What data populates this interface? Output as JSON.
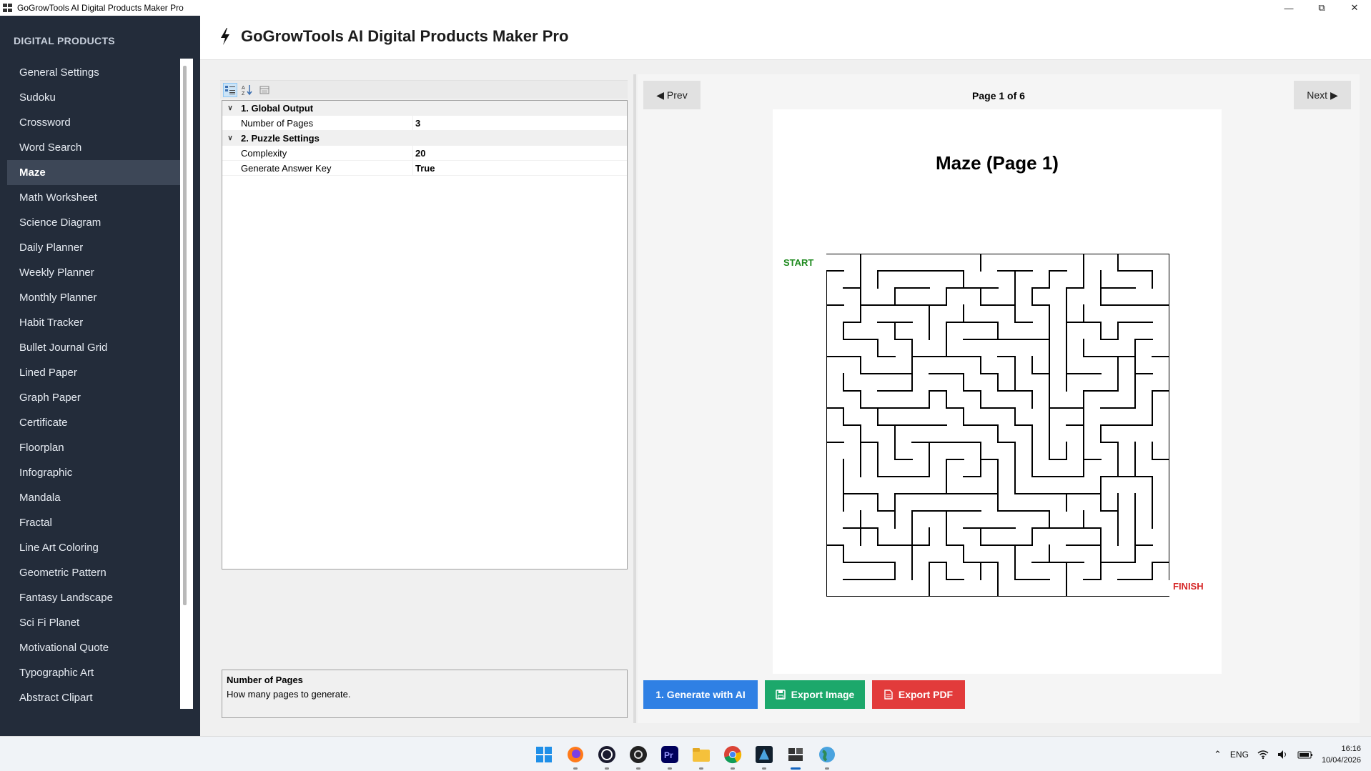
{
  "window": {
    "title": "GoGrowTools AI Digital Products Maker Pro",
    "controls": [
      "minimize",
      "restore",
      "close"
    ]
  },
  "sidebar": {
    "heading": "DIGITAL PRODUCTS",
    "items": [
      {
        "label": "General Settings"
      },
      {
        "label": "Sudoku"
      },
      {
        "label": "Crossword"
      },
      {
        "label": "Word Search"
      },
      {
        "label": "Maze",
        "active": true
      },
      {
        "label": "Math Worksheet"
      },
      {
        "label": "Science Diagram"
      },
      {
        "label": "Daily Planner"
      },
      {
        "label": "Weekly Planner"
      },
      {
        "label": "Monthly Planner"
      },
      {
        "label": "Habit Tracker"
      },
      {
        "label": "Bullet Journal Grid"
      },
      {
        "label": "Lined Paper"
      },
      {
        "label": "Graph Paper"
      },
      {
        "label": "Certificate"
      },
      {
        "label": "Floorplan"
      },
      {
        "label": "Infographic"
      },
      {
        "label": "Mandala"
      },
      {
        "label": "Fractal"
      },
      {
        "label": "Line Art Coloring"
      },
      {
        "label": "Geometric Pattern"
      },
      {
        "label": "Fantasy Landscape"
      },
      {
        "label": "Sci Fi Planet"
      },
      {
        "label": "Motivational Quote"
      },
      {
        "label": "Typographic Art"
      },
      {
        "label": "Abstract Clipart"
      }
    ]
  },
  "header": {
    "title": "GoGrowTools AI Digital Products Maker Pro",
    "icon": "lightning-bolt-icon"
  },
  "property_grid": {
    "categories": [
      {
        "name": "1. Global Output",
        "properties": [
          {
            "name": "Number of Pages",
            "value": "3"
          }
        ]
      },
      {
        "name": "2. Puzzle Settings",
        "properties": [
          {
            "name": "Complexity",
            "value": "20"
          },
          {
            "name": "Generate Answer Key",
            "value": "True"
          }
        ]
      }
    ],
    "description": {
      "title": "Number of Pages",
      "text": "How many pages to generate."
    }
  },
  "preview": {
    "prev_label": "◀ Prev",
    "next_label": "Next ▶",
    "page_label": "Page 1 of 6",
    "page_title": "Maze  (Page 1)",
    "start_label": "START",
    "finish_label": "FINISH",
    "start_color": "#1e8a1e",
    "finish_color": "#d62828"
  },
  "actions": {
    "generate_label": "1. Generate with AI",
    "export_image_label": "Export Image",
    "export_pdf_label": "Export PDF",
    "generate_color": "#2f80e4",
    "export_image_color": "#1ca86b",
    "export_pdf_color": "#e23b3b"
  },
  "taskbar": {
    "apps": [
      "windows-start-icon",
      "firefox-icon",
      "obs-icon",
      "davinci-icon",
      "premiere-icon",
      "file-explorer-icon",
      "chrome-icon",
      "inkscape-icon",
      "app-window-icon",
      "earth-icon"
    ],
    "tray": {
      "language": "ENG",
      "time": "16:16",
      "date": "10/04/2026"
    }
  }
}
